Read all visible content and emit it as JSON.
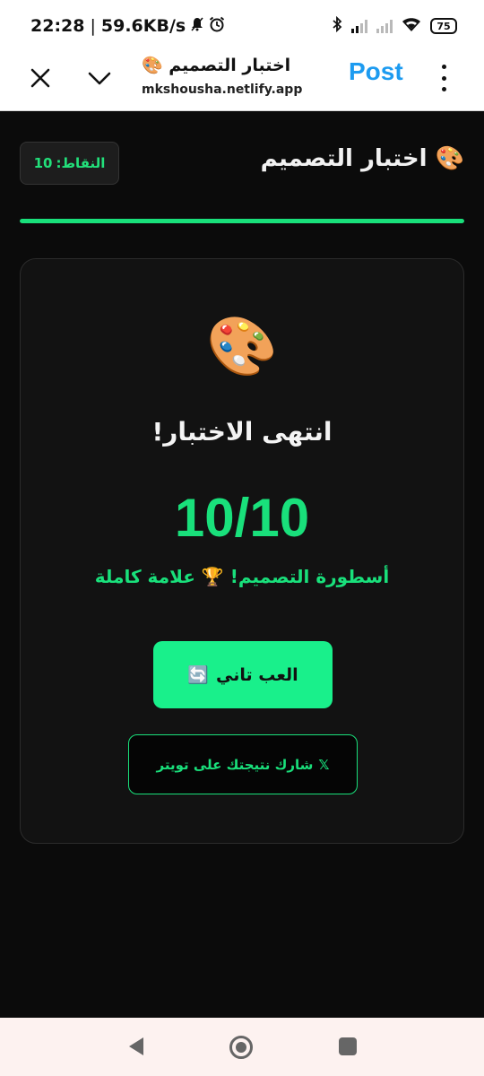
{
  "status_bar": {
    "time": "22:28",
    "separator": "|",
    "net_speed": "59.6KB/s",
    "mute_icon": "bell-slash-icon",
    "alarm_icon": "alarm-clock-icon",
    "bluetooth_icon": "bluetooth-icon",
    "wifi_icon": "wifi-icon",
    "battery_level": "75"
  },
  "browser": {
    "page_title": "اختبار التصميم 🎨",
    "url": "mkshousha.netlify.app",
    "post_label": "Post",
    "post_color": "#1d9bf0"
  },
  "quiz": {
    "title": "🎨 اختبار التصميم",
    "points_label": "النقاط:",
    "points_value": "10",
    "progress": 1.0,
    "accent_color": "#19e07b"
  },
  "result": {
    "icon": "🎨",
    "heading": "انتهى الاختبار!",
    "score": "10/10",
    "message": "أسطورة التصميم! 🏆 علامة كاملة",
    "play_again_label": "العب تاني",
    "play_again_icon": "🔄",
    "share_icon": "𝕏",
    "share_label": "شارك نتيجتك على تويتر"
  }
}
